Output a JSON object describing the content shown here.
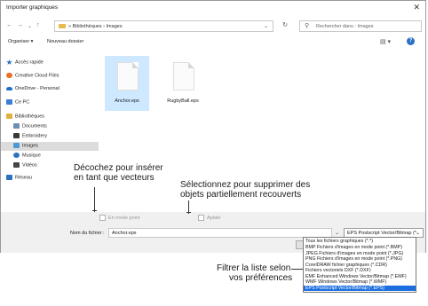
{
  "window": {
    "title": "Importer graphiques"
  },
  "address": {
    "path_root": "»",
    "path_parent": "Bibliothèques",
    "path_current": "Images",
    "search_placeholder": "Rechercher dans : Images"
  },
  "toolbar": {
    "organize": "Organiser ▾",
    "new_folder": "Nouveau dossier"
  },
  "sidebar": {
    "items": [
      {
        "label": "Accès rapide",
        "icon": "star-icon",
        "color": "#2a71c4"
      },
      {
        "label": "Creative Cloud Files",
        "icon": "creative-cloud-icon",
        "color": "#e8712a"
      },
      {
        "label": "OneDrive - Personal",
        "icon": "cloud-icon",
        "color": "#1e6fd0"
      },
      {
        "label": "Ce PC",
        "icon": "computer-icon",
        "color": "#3b7dd8"
      },
      {
        "label": "Bibliothèques",
        "icon": "library-icon",
        "color": "#e0b040"
      },
      {
        "label": "Documents",
        "icon": "documents-icon",
        "color": "#6b8fb5"
      },
      {
        "label": "Embroidery",
        "icon": "folder-icon",
        "color": "#3a3a3a"
      },
      {
        "label": "Images",
        "icon": "images-icon",
        "color": "#4a9ad8"
      },
      {
        "label": "Musique",
        "icon": "music-icon",
        "color": "#2a71c4"
      },
      {
        "label": "Vidéos",
        "icon": "video-icon",
        "color": "#444444"
      },
      {
        "label": "Réseau",
        "icon": "network-icon",
        "color": "#2a71c4"
      }
    ]
  },
  "files": [
    {
      "name": "Anchor.eps"
    },
    {
      "name": "RugbyBall.eps"
    }
  ],
  "options": {
    "in_hoop": "En mode point",
    "flatten": "Aplatir"
  },
  "filename": {
    "label": "Nom du fichier :",
    "value": "Anchor.eps"
  },
  "filetype": {
    "selected": "EPS Postscript Vector/Bitmap (*",
    "options": [
      "Tous les fichiers graphiques (*.*)",
      "BMP Fichiers d'images en mode point (*.BMP)",
      "JPEG Fichiers d'images en mode point (*.JPG)",
      "PNG Fichiers d'images en mode point (*.PNG)",
      "CorelDRAW fichier graphiques (*.CDR)",
      "Fichiers vectoriels DXF (*.DXF)",
      "EMF Enhanced Windows Vector/Bitmap (*.EMF)",
      "WMF Windows Vector/Bitmap (*.WMF)",
      "EPS Postscript Vector/Bitmap (*.EPS)"
    ]
  },
  "callouts": {
    "uncheck_1": "Décochez pour insérer",
    "uncheck_2": "en tant que vecteurs",
    "select_1": "Sélectionnez pour supprimer des",
    "select_2": "objets partiellement recouverts",
    "filter_1": "Filtrer la liste selon",
    "filter_2": "vos préférences"
  }
}
